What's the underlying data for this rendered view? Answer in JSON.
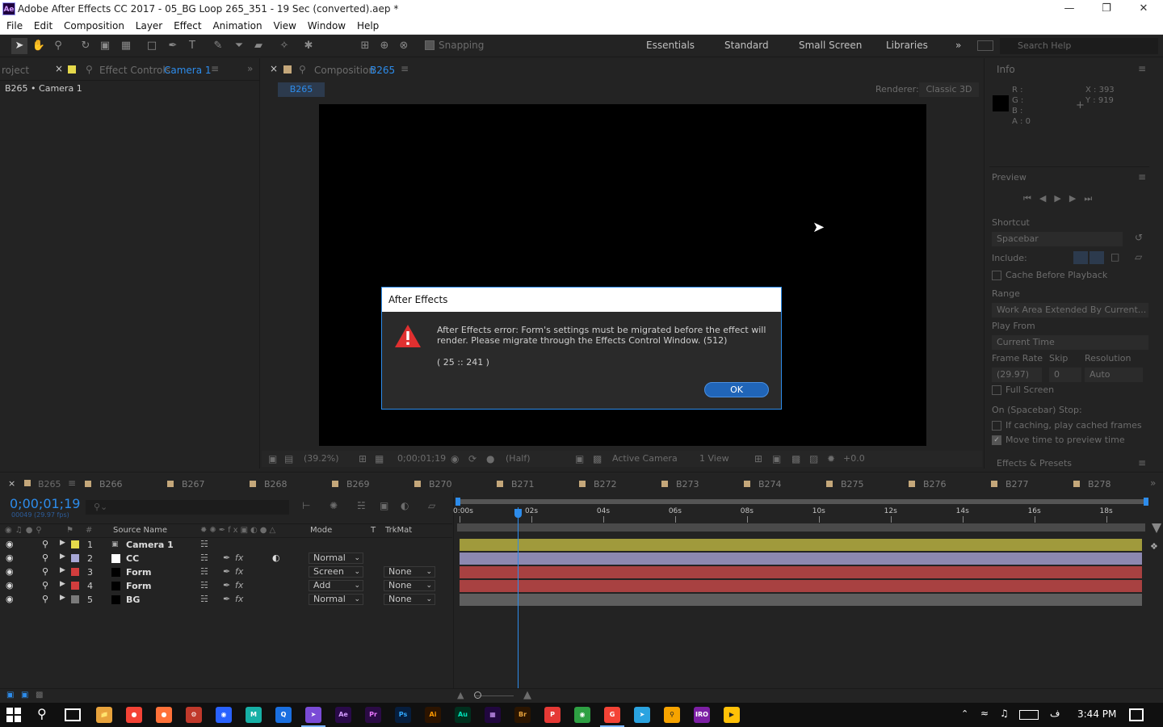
{
  "window": {
    "title": "Adobe After Effects CC 2017 - 05_BG Loop 265_351 - 19 Sec (converted).aep *",
    "logo": "Ae",
    "minimize_icon": "minimize-icon",
    "restore_icon": "restore-icon",
    "close_icon": "close-icon"
  },
  "menu": [
    "File",
    "Edit",
    "Composition",
    "Layer",
    "Effect",
    "Animation",
    "View",
    "Window",
    "Help"
  ],
  "toolbar": {
    "snapping_label": "Snapping",
    "workspaces": [
      "Essentials",
      "Standard",
      "Small Screen",
      "Libraries"
    ],
    "search_placeholder": "Search Help"
  },
  "left_panel": {
    "project_tab": "roject",
    "effect_controls_label": "Effect Controls",
    "effect_controls_target": "Camera 1",
    "breadcrumb": "B265 • Camera 1"
  },
  "composition_panel": {
    "tab_label": "Composition",
    "tab_target": "B265",
    "active_comp": "B265",
    "renderer_label": "Renderer:",
    "renderer_value": "Classic 3D",
    "footer": {
      "zoom": "(39.2%)",
      "timecode": "0;00;01;19",
      "resolution": "(Half)",
      "camera": "Active Camera",
      "views": "1 View",
      "exposure": "+0.0"
    }
  },
  "info_panel": {
    "title": "Info",
    "r": "R :",
    "g": "G :",
    "b": "B :",
    "a": "A : 0",
    "x": "X : 393",
    "y": "Y : 919"
  },
  "preview_panel": {
    "title": "Preview",
    "shortcut_label": "Shortcut",
    "shortcut_value": "Spacebar",
    "include_label": "Include:",
    "cache_before_playback": "Cache Before Playback",
    "range_label": "Range",
    "range_value": "Work Area Extended By Current...",
    "play_from_label": "Play From",
    "play_from_value": "Current Time",
    "frame_rate_label": "Frame Rate",
    "skip_label": "Skip",
    "resolution_label": "Resolution",
    "frame_rate_value": "(29.97)",
    "skip_value": "0",
    "resolution_value": "Auto",
    "full_screen": "Full Screen",
    "on_stop_label": "On (Spacebar) Stop:",
    "if_caching": "If caching, play cached frames",
    "move_time": "Move time to preview time",
    "move_time_checked": true
  },
  "effects_presets": "Effects & Presets",
  "dialog": {
    "title": "After Effects",
    "message": "After Effects error: Form's settings must be migrated before the effect will render. Please migrate through the Effects Control Window.  (512)",
    "code": "( 25 :: 241 )",
    "ok_label": "OK"
  },
  "timeline": {
    "tabs": [
      "B265",
      "B266",
      "B267",
      "B268",
      "B269",
      "B270",
      "B271",
      "B272",
      "B273",
      "B274",
      "B275",
      "B276",
      "B277",
      "B278"
    ],
    "current_time": "0;00;01;19",
    "frame_info": "00049 (29.97 fps)",
    "columns": {
      "num": "#",
      "source_name": "Source Name",
      "mode": "Mode",
      "t": "T",
      "trkmat": "TrkMat"
    },
    "ruler": [
      "0:00s",
      "02s",
      "04s",
      "06s",
      "08s",
      "10s",
      "12s",
      "14s",
      "16s",
      "18s"
    ],
    "duration_sec": 19,
    "current_sec": 1.63,
    "layers": [
      {
        "num": "1",
        "name": "Camera 1",
        "label_color": "#e5d94b",
        "mode": "",
        "trkmat": "",
        "bar_color": "#a09a3c"
      },
      {
        "num": "2",
        "name": "CC",
        "label_color": "#a8a8d6",
        "mode": "Normal",
        "trkmat": "",
        "bar_color": "#8c88b0"
      },
      {
        "num": "3",
        "name": "Form",
        "label_color": "#d13d3d",
        "mode": "Screen",
        "trkmat": "None",
        "bar_color": "#a84141"
      },
      {
        "num": "4",
        "name": "Form",
        "label_color": "#d13d3d",
        "mode": "Add",
        "trkmat": "None",
        "bar_color": "#a84141"
      },
      {
        "num": "5",
        "name": "BG",
        "label_color": "#7a7a7a",
        "mode": "Normal",
        "trkmat": "None",
        "bar_color": "#5e5e5e"
      }
    ]
  },
  "taskbar": {
    "apps": [
      "Chrome",
      "Firefox",
      "Game",
      "Mail",
      "M",
      "Q",
      "VS",
      "Ae",
      "Pr",
      "Ps",
      "Ai",
      "Au",
      "Ae2",
      "Br",
      "P",
      "Edge",
      "G",
      "Telegram",
      "Search",
      "IRO",
      "Player",
      "Flag"
    ],
    "lang": "ف",
    "time": "3:44 PM"
  }
}
